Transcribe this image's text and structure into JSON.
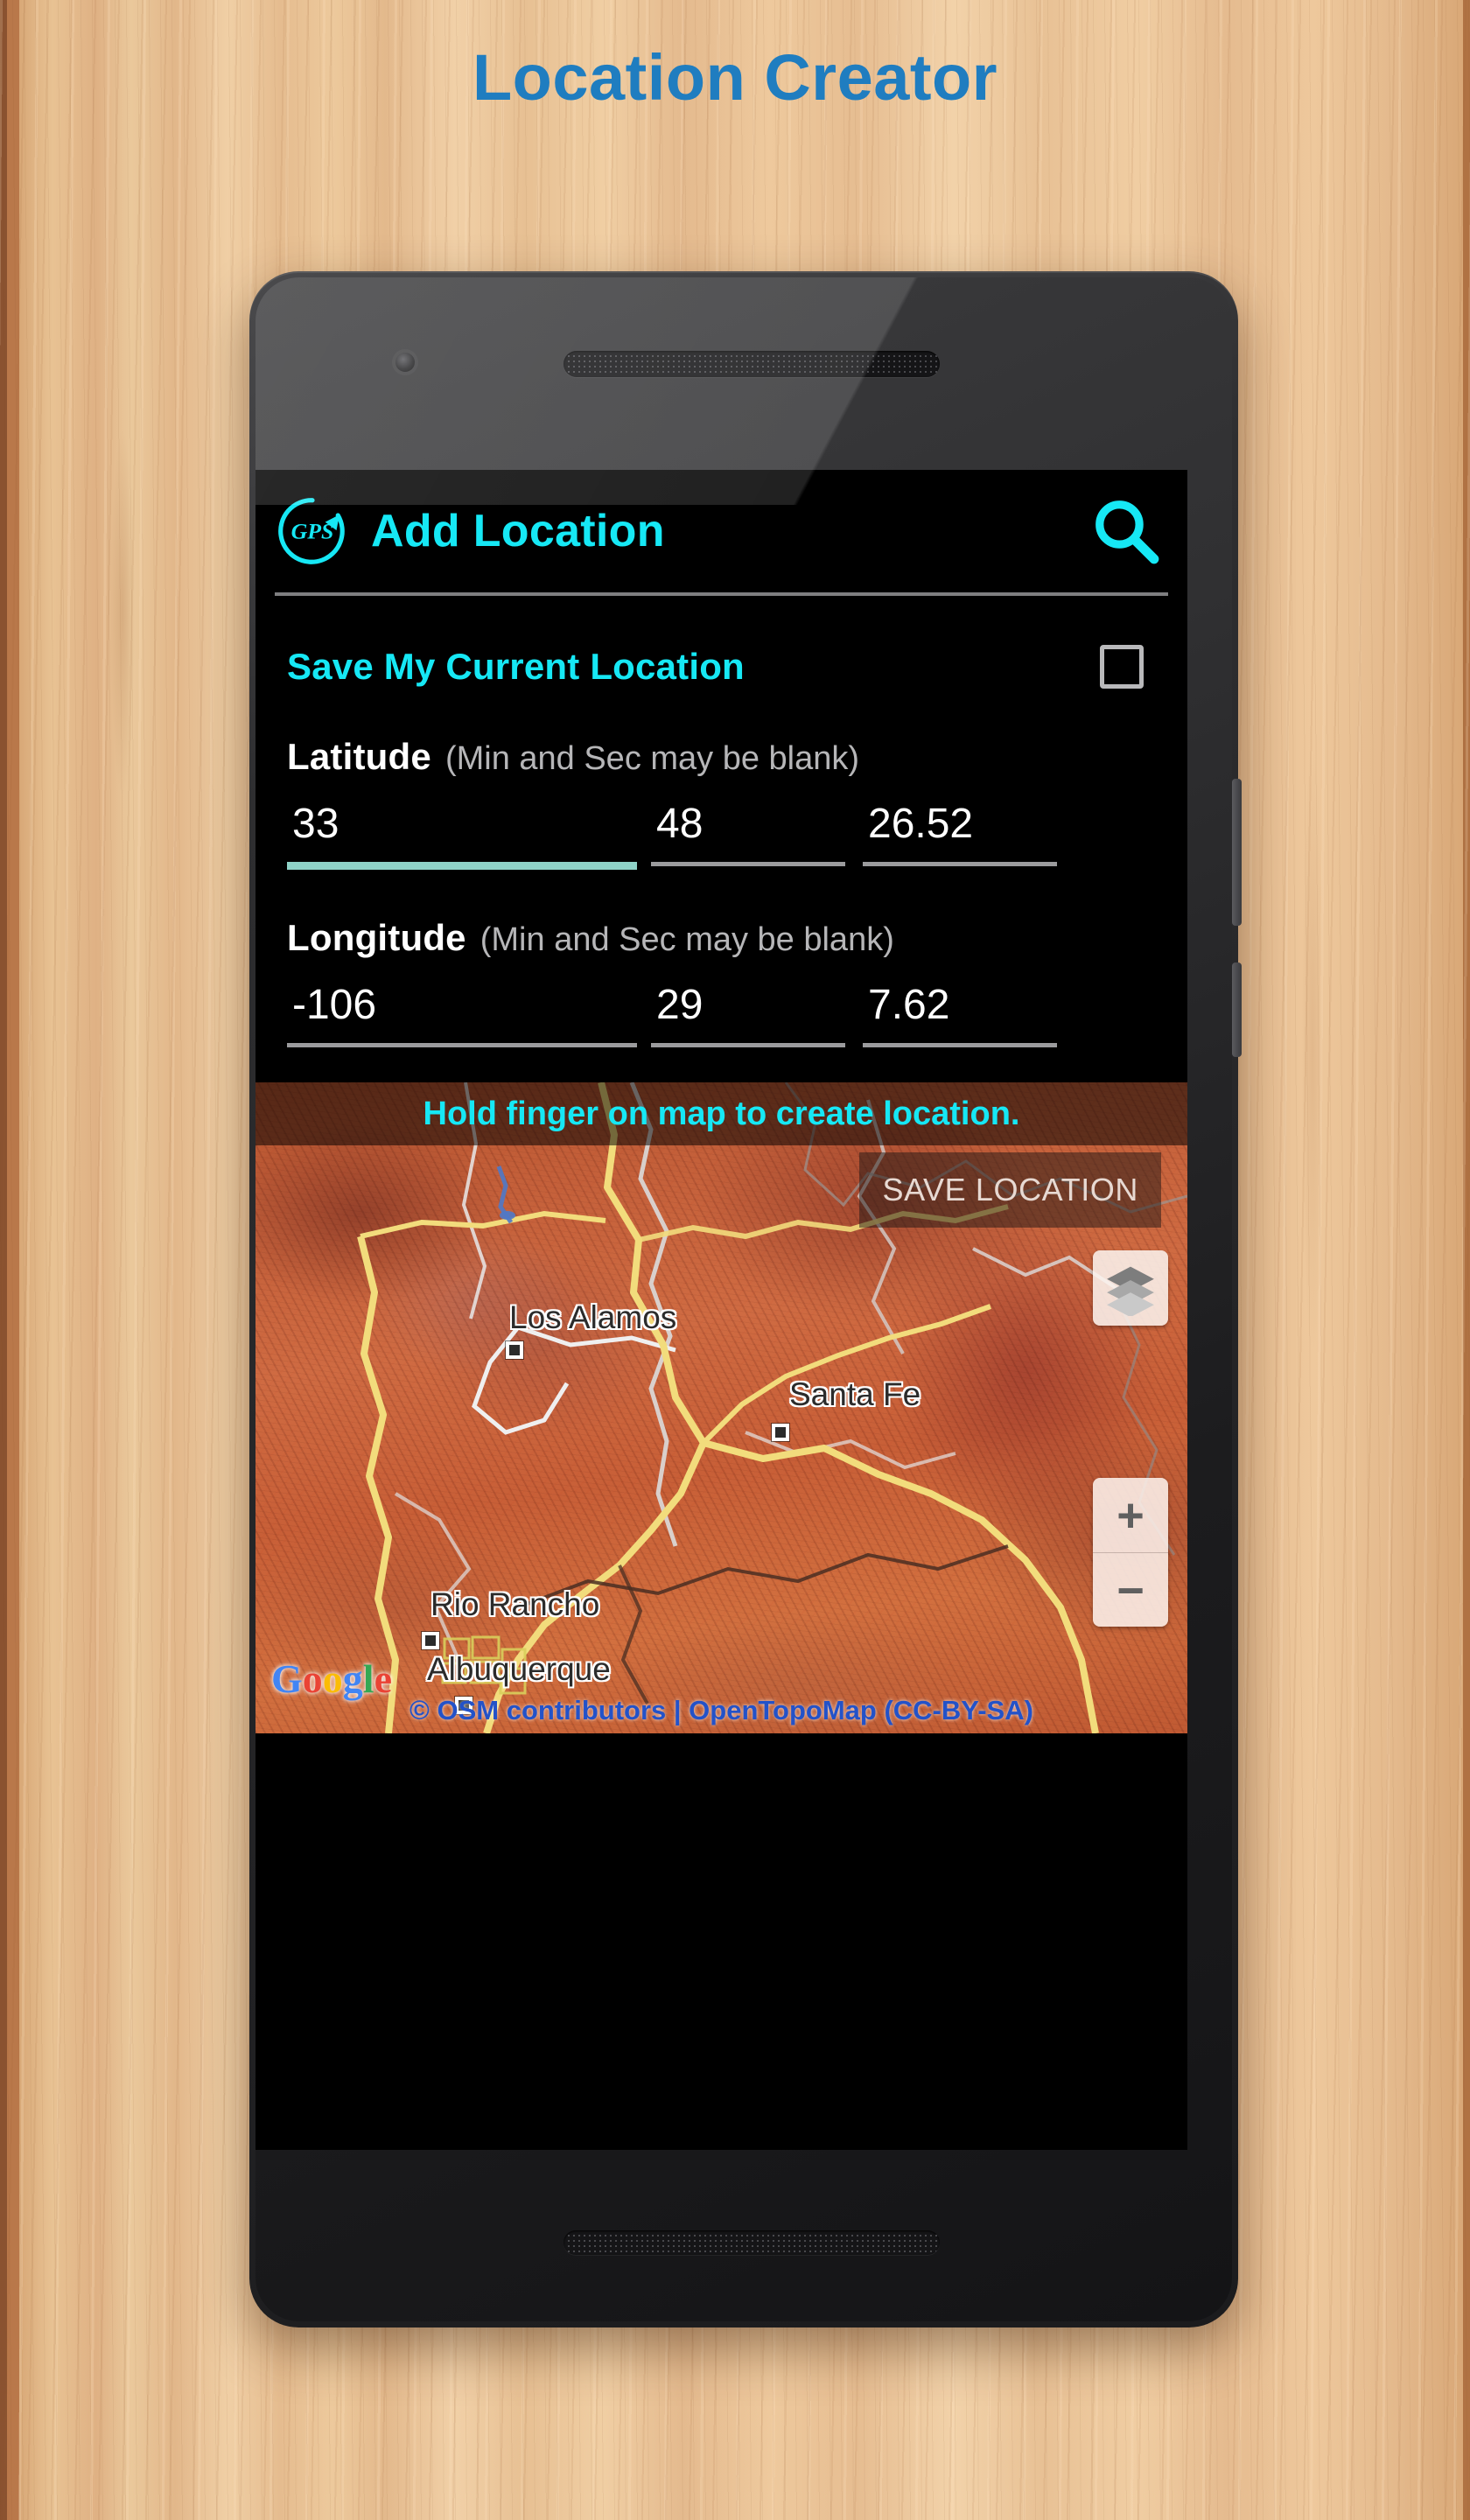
{
  "page": {
    "title": "Location Creator"
  },
  "app": {
    "logo_icon": "gps-circular-arrow-icon",
    "title": "Add Location",
    "search_icon": "search-icon"
  },
  "form": {
    "save_current_location_label": "Save My Current Location",
    "save_current_location_checked": false,
    "latitude": {
      "label": "Latitude",
      "hint": "(Min and Sec may be blank)",
      "degrees": "33",
      "minutes": "48",
      "seconds": "26.52",
      "focused_field": "degrees"
    },
    "longitude": {
      "label": "Longitude",
      "hint": "(Min and Sec may be blank)",
      "degrees": "-106",
      "minutes": "29",
      "seconds": "7.62",
      "focused_field": "none"
    }
  },
  "map": {
    "hint": "Hold finger on map to create location.",
    "save_button": "SAVE LOCATION",
    "layers_icon": "layers-stack-icon",
    "zoom_in": "+",
    "zoom_out": "−",
    "provider_logo": "google-logo",
    "attribution": "© OSM contributors | OpenTopoMap (CC-BY-SA)",
    "places": [
      {
        "name": "Los Alamos"
      },
      {
        "name": "Santa Fe"
      },
      {
        "name": "Rio Rancho"
      },
      {
        "name": "Albuquerque"
      }
    ]
  },
  "colors": {
    "heading": "#1f7dc0",
    "accent_cyan": "#16e8f5",
    "focused_underline": "#8fd3c8",
    "attribution_blue": "#2352c8"
  }
}
